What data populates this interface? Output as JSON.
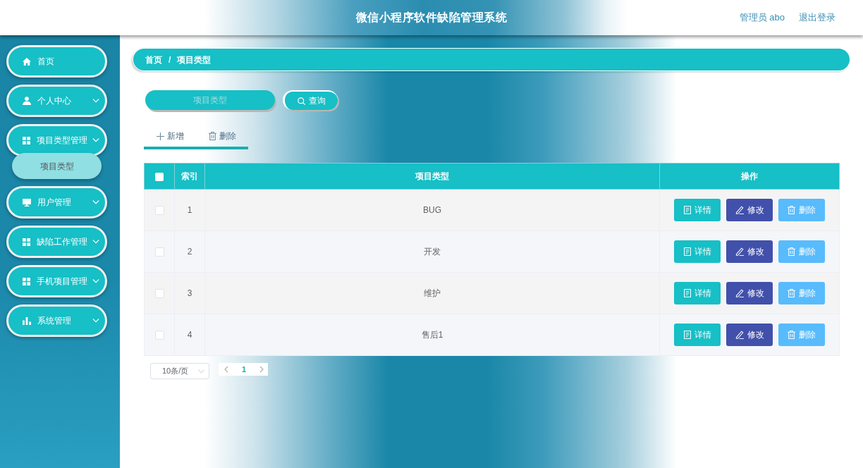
{
  "header": {
    "title": "微信小程序软件缺陷管理系统",
    "user": "管理员 abo",
    "logout": "退出登录"
  },
  "sidebar": {
    "items": [
      {
        "label": "首页",
        "kind": "link"
      },
      {
        "label": "个人中心",
        "kind": "menu"
      },
      {
        "label": "项目类型管理",
        "kind": "menu",
        "children": [
          {
            "label": "项目类型",
            "selected": true
          }
        ]
      },
      {
        "label": "用户管理",
        "kind": "menu"
      },
      {
        "label": "缺陷工作管理",
        "kind": "menu"
      },
      {
        "label": "手机项目管理",
        "kind": "menu"
      },
      {
        "label": "系统管理",
        "kind": "menu"
      }
    ]
  },
  "breadcrumb": {
    "items": [
      "首页",
      "项目类型"
    ],
    "separator": "/"
  },
  "search": {
    "placeholder": "项目类型",
    "button": "查询"
  },
  "toolbar": [
    {
      "label": "新增",
      "kind": "add"
    },
    {
      "label": "删除",
      "kind": "delete"
    }
  ],
  "table": {
    "columns": [
      {
        "kind": "checkbox",
        "checked": false
      },
      {
        "kind": "text",
        "label": "索引"
      },
      {
        "kind": "text",
        "label": "项目类型"
      },
      {
        "kind": "text",
        "label": "操作"
      }
    ],
    "rows": [
      {
        "checked": false,
        "index": "1",
        "type": "BUG",
        "actions": [
          {
            "label": "详情",
            "kind": "detail"
          },
          {
            "label": "修改",
            "kind": "edit"
          },
          {
            "label": "删除",
            "kind": "delete"
          }
        ]
      },
      {
        "checked": false,
        "index": "2",
        "type": "开发",
        "actions": [
          {
            "label": "详情",
            "kind": "detail"
          },
          {
            "label": "修改",
            "kind": "edit"
          },
          {
            "label": "删除",
            "kind": "delete"
          }
        ]
      },
      {
        "checked": false,
        "index": "3",
        "type": "维护",
        "actions": [
          {
            "label": "详情",
            "kind": "detail"
          },
          {
            "label": "修改",
            "kind": "edit"
          },
          {
            "label": "删除",
            "kind": "delete"
          }
        ]
      },
      {
        "checked": false,
        "index": "4",
        "type": "售后1",
        "actions": [
          {
            "label": "详情",
            "kind": "detail"
          },
          {
            "label": "修改",
            "kind": "edit"
          },
          {
            "label": "删除",
            "kind": "delete"
          }
        ]
      }
    ]
  },
  "pagination": {
    "page_size": "10条/页",
    "pages": [
      {
        "label": "1",
        "selected": true
      }
    ]
  }
}
